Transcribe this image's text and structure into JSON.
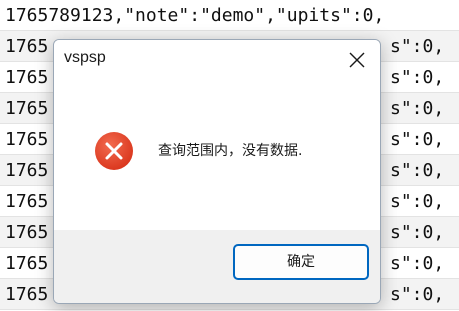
{
  "editor": {
    "lines": [
      "1765789123,\"note\":\"demo\",\"upits\":0,",
      "1765",
      "1765",
      "1765",
      "1765",
      "1765",
      "1765",
      "1765",
      "1765",
      "1765"
    ],
    "right_fragments": [
      "s\":0,",
      "s\":0,",
      "s\":0,",
      "s\":0,",
      "s\":0,",
      "s\":0,",
      "s\":0,",
      "s\":0,",
      "s\":0,"
    ]
  },
  "dialog": {
    "title": "vspsp",
    "message": "查询范围内，没有数据.",
    "ok_label": "确定",
    "icon": "error-icon",
    "close_icon": "close-icon",
    "colors": {
      "error_red": "#e5432a",
      "button_border": "#0067c0"
    }
  }
}
